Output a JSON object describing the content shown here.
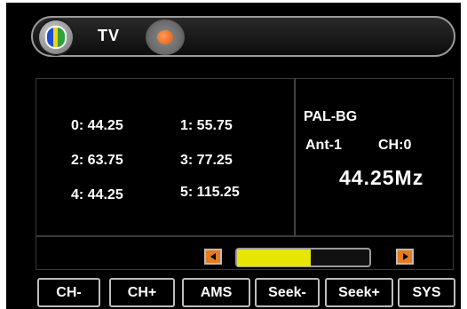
{
  "header": {
    "title": "TV",
    "icons": {
      "tv": "tv-logo-icon",
      "status": "status-dot-icon"
    }
  },
  "channels": [
    {
      "label": "0: 44.25"
    },
    {
      "label": "1: 55.75"
    },
    {
      "label": "2: 63.75"
    },
    {
      "label": "3: 77.25"
    },
    {
      "label": "4: 44.25"
    },
    {
      "label": "5: 115.25"
    }
  ],
  "info": {
    "system": "PAL-BG",
    "antenna": "Ant-1",
    "channel": "CH:0",
    "frequency": "44.25Mz"
  },
  "slider": {
    "value_fraction": 0.56,
    "fill_color": "#e6e600",
    "left_icon": "arrow-left-icon",
    "right_icon": "arrow-right-icon"
  },
  "buttons": [
    "CH-",
    "CH+",
    "AMS",
    "Seek-",
    "Seek+",
    "SYS"
  ]
}
